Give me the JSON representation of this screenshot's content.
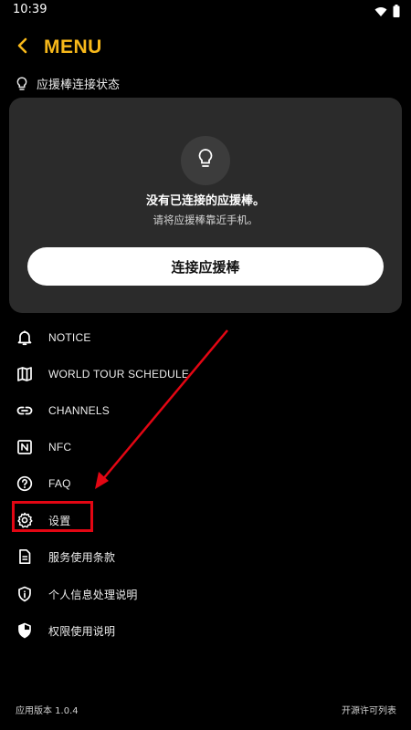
{
  "status_bar": {
    "time": "10:39",
    "icons": [
      "wifi-icon",
      "battery-icon"
    ]
  },
  "header": {
    "title": "MENU",
    "back_icon": "chevron-left-icon"
  },
  "connection": {
    "section_label": "应援棒连接状态",
    "message_title": "没有已连接的应援棒。",
    "message_sub": "请将应援棒靠近手机。",
    "connect_button": "连接应援棒"
  },
  "menu": {
    "items": [
      {
        "label": "NOTICE",
        "icon": "bell-icon"
      },
      {
        "label": "WORLD TOUR SCHEDULE",
        "icon": "map-icon"
      },
      {
        "label": "CHANNELS",
        "icon": "link-icon"
      },
      {
        "label": "NFC",
        "icon": "nfc-icon"
      },
      {
        "label": "FAQ",
        "icon": "help-circle-icon"
      },
      {
        "label": "设置",
        "icon": "gear-icon"
      },
      {
        "label": "服务使用条款",
        "icon": "document-icon"
      },
      {
        "label": "个人信息处理说明",
        "icon": "shield-info-icon"
      },
      {
        "label": "权限使用说明",
        "icon": "shield-half-icon"
      }
    ]
  },
  "footer": {
    "version": "应用版本 1.0.4",
    "licenses": "开源许可列表"
  },
  "colors": {
    "accent": "#f7b81a",
    "background": "#000000",
    "card": "#2b2b2b",
    "annotation": "#e30613"
  }
}
